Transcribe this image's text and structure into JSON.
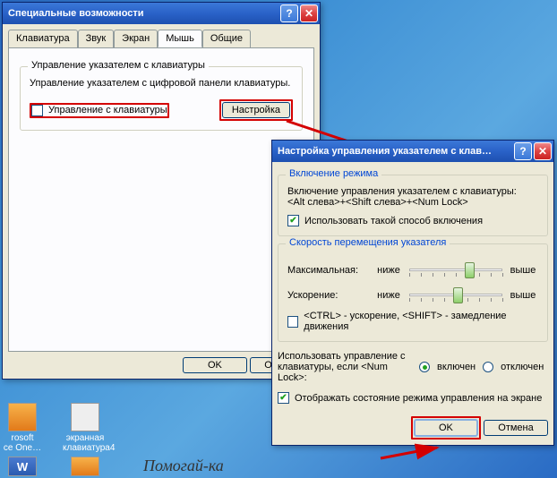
{
  "window1": {
    "title": "Специальные возможности",
    "tabs": [
      "Клавиатура",
      "Звук",
      "Экран",
      "Мышь",
      "Общие"
    ],
    "activeTab": 3,
    "group_title": "Управление указателем с клавиатуры",
    "group_desc": "Управление указателем с цифровой панели клавиатуры.",
    "cb_label": "Управление с клавиатуры",
    "settings_btn": "Настройка",
    "ok": "OK",
    "cancel": "Отмена"
  },
  "window2": {
    "title": "Настройка управления указателем с клав…",
    "group1_title": "Включение режима",
    "group1_desc": "Включение управления указателем с клавиатуры:\n<Alt слева>+<Shift слева>+<Num Lock>",
    "group1_cb": "Использовать такой способ включения",
    "group2_title": "Скорость перемещения указателя",
    "max_label": "Максимальная:",
    "accel_label": "Ускорение:",
    "low": "ниже",
    "high": "выше",
    "ctrl_shift": "<CTRL> - ускорение, <SHIFT> - замедление движения",
    "numlock_text": "Использовать управление с клавиатуры, если <Num Lock>:",
    "radio_on": "включен",
    "radio_off": "отключен",
    "show_state": "Отображать состояние режима управления на экране",
    "ok": "OK",
    "cancel": "Отмена"
  },
  "desktop": {
    "icon1": "rosoft\nce One…",
    "icon2": "экранная\nклавиатура4"
  },
  "watermark": "Помогай-ка"
}
